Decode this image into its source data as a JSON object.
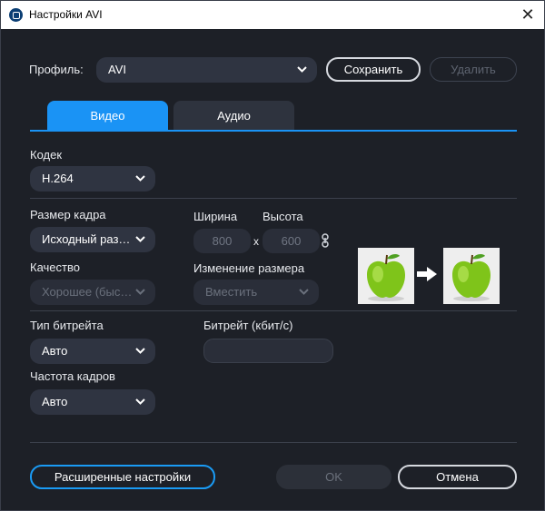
{
  "window": {
    "title": "Настройки AVI",
    "close_glyph": "✕"
  },
  "profile": {
    "label": "Профиль:",
    "value": "AVI",
    "save_label": "Сохранить",
    "delete_label": "Удалить"
  },
  "tabs": [
    {
      "label": "Видео",
      "active": true
    },
    {
      "label": "Аудио",
      "active": false
    }
  ],
  "codec": {
    "label": "Кодек",
    "value": "H.264"
  },
  "frame_size": {
    "label": "Размер кадра",
    "value": "Исходный раз…"
  },
  "width": {
    "label": "Ширина",
    "value": "800"
  },
  "height": {
    "label": "Высота",
    "value": "600"
  },
  "size_separator": "x",
  "quality": {
    "label": "Качество",
    "value": "Хорошее (быс…"
  },
  "resize": {
    "label": "Изменение размера",
    "value": "Вместить"
  },
  "bitrate_type": {
    "label": "Тип битрейта",
    "value": "Авто"
  },
  "bitrate": {
    "label": "Битрейт (кбит/с)",
    "value": ""
  },
  "frame_rate": {
    "label": "Частота кадров",
    "value": "Авто"
  },
  "footer": {
    "advanced_label": "Расширенные настройки",
    "ok_label": "OK",
    "cancel_label": "Отмена"
  },
  "colors": {
    "background": "#1d2027",
    "accent": "#1a93f5",
    "control": "#2f3441"
  }
}
